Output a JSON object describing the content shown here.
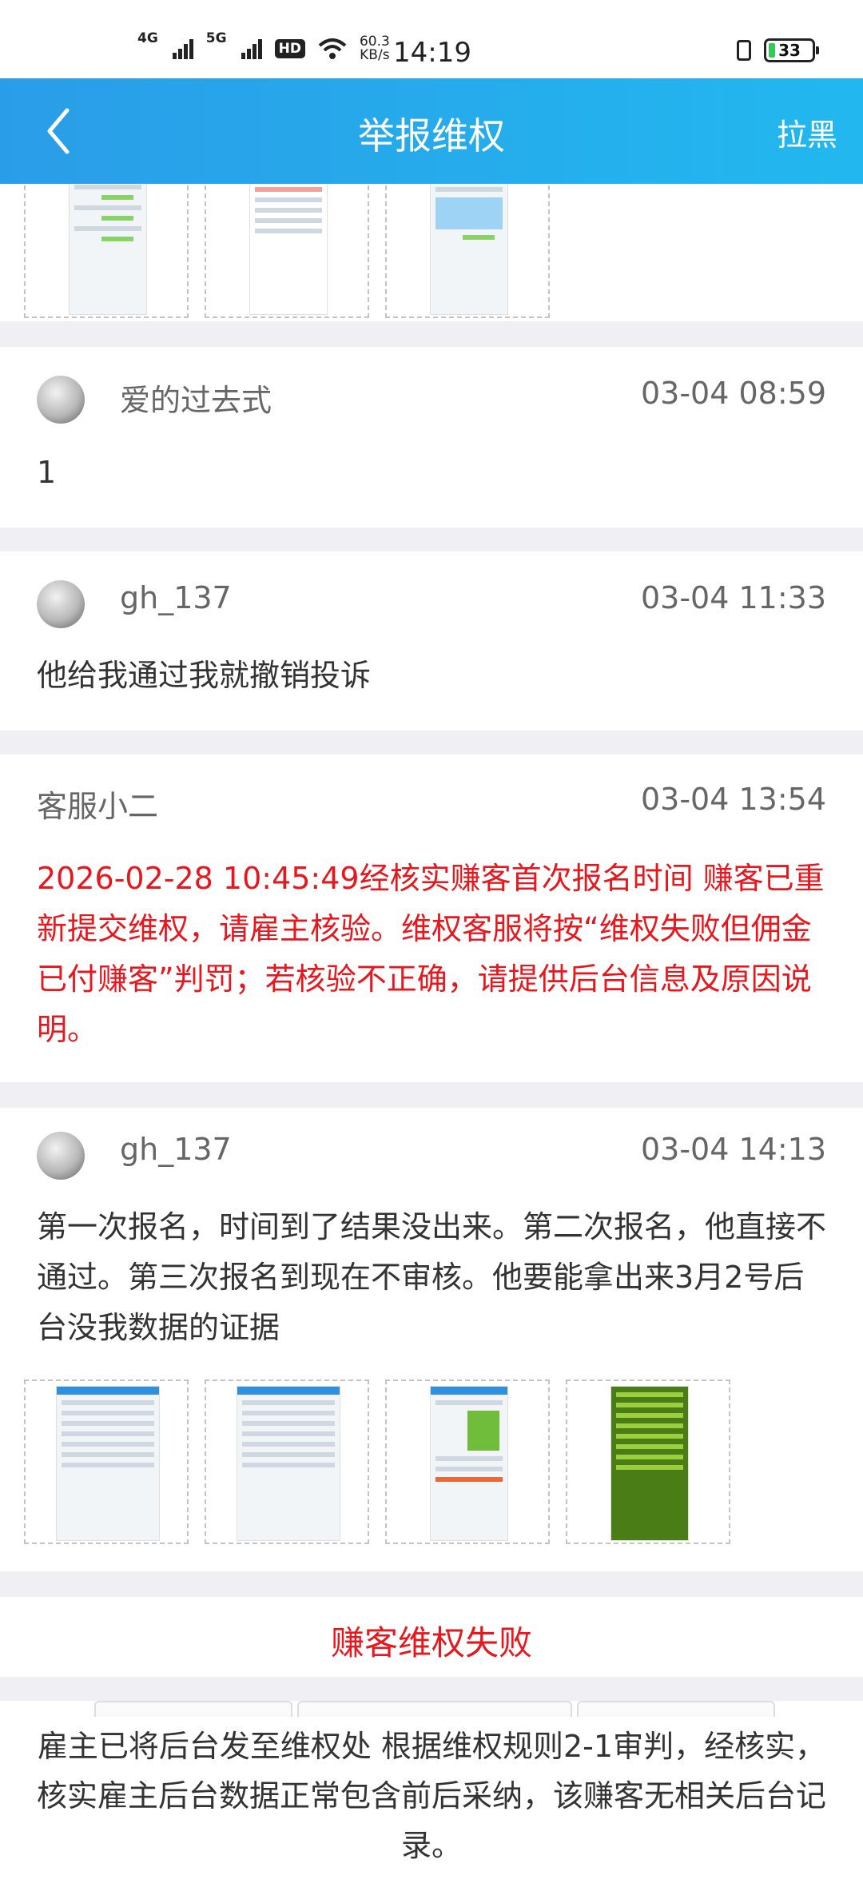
{
  "status_bar": {
    "sig1": "4G",
    "sig2": "5G",
    "hd": "HD",
    "speed_value": "60.3",
    "speed_unit": "KB/s",
    "time": "14:19",
    "battery": "33"
  },
  "header": {
    "title": "举报维权",
    "right_action": "拉黑",
    "back_icon": "chevron-left-icon"
  },
  "posts": [
    {
      "user": "爱的过去式",
      "time": "03-04 08:59",
      "text": "1"
    },
    {
      "user": "gh_137",
      "time": "03-04 11:33",
      "text": "他给我通过我就撤销投诉"
    },
    {
      "user": "客服小二",
      "time": "03-04 13:54",
      "text": "2026-02-28 10:45:49经核实赚客首次报名时间 赚客已重新提交维权，请雇主核验。维权客服将按“维权失败但佣金已付赚客”判罚；若核验不正确，请提供后台信息及原因说明。"
    },
    {
      "user": "gh_137",
      "time": "03-04 14:13",
      "text": "第一次报名，时间到了结果没出来。第二次报名，他直接不通过。第三次报名到现在不审核。他要能拿出来3月2号后台没我数据的证据"
    }
  ],
  "result": {
    "label": "赚客维权失败",
    "detail": "雇主已将后台发至维权处 根据维权规则2-1审判，经核实，核实雇主后台数据正常包含前后采纳，该赚客无相关后台记录。"
  },
  "colors": {
    "header_start": "#2a9de8",
    "header_end": "#22b8ef",
    "alert_red": "#e8171d",
    "background": "#efeff4"
  }
}
